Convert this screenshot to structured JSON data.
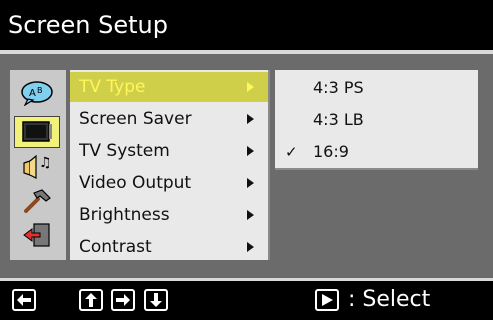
{
  "header": {
    "title": "Screen Setup"
  },
  "icons": [
    "language-icon",
    "tv-icon",
    "audio-icon",
    "tools-icon",
    "exit-icon"
  ],
  "menu": {
    "items": [
      {
        "label": "TV Type",
        "active": true
      },
      {
        "label": "Screen Saver"
      },
      {
        "label": "TV System"
      },
      {
        "label": "Video Output"
      },
      {
        "label": "Brightness"
      },
      {
        "label": "Contrast"
      }
    ]
  },
  "submenu": {
    "items": [
      {
        "label": "4:3 PS",
        "check": ""
      },
      {
        "label": "4:3 LB",
        "check": ""
      },
      {
        "label": "16:9",
        "check": "✓"
      }
    ]
  },
  "footer": {
    "select_label": ": Select"
  },
  "colors": {
    "header_bg": "#000000",
    "screen_bg": "#6b6b6b",
    "menu_bg": "#e9e9e9",
    "highlight_bg": "#cfcf4a",
    "highlight_text": "#fff65a"
  }
}
